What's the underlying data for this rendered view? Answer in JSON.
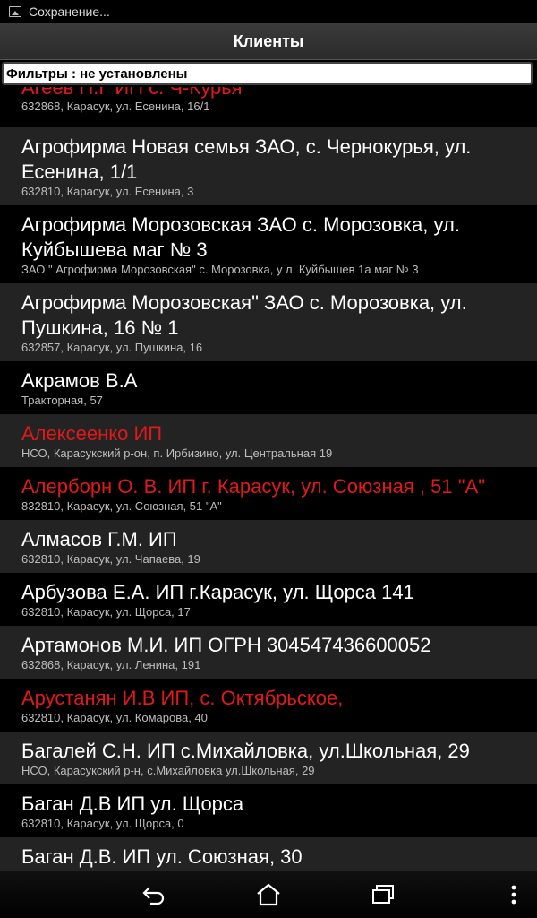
{
  "status": {
    "text": "Сохранение..."
  },
  "header": {
    "title": "Клиенты"
  },
  "filter": {
    "text": "Фильтры : не установлены"
  },
  "clients": [
    {
      "name": "Агеев П.Г ИП с. Ч-Курья",
      "address": "632868, Карасук, ул. Есенина, 16/1",
      "red": true
    },
    {
      "name": "Агрофирма  Новая семья ЗАО, с. Чернокурья, ул. Есенина, 1/1",
      "address": "632810, Карасук, ул. Есенина, 3",
      "red": false
    },
    {
      "name": "Агрофирма Морозовская ЗАО с. Морозовка, ул. Куйбышева маг № 3",
      "address": "ЗАО \" Агрофирма Морозовская\" с. Морозовка, у л. Куйбышев 1а маг № 3",
      "red": false
    },
    {
      "name": "Агрофирма Морозовская\" ЗАО с. Морозовка, ул. Пушкина, 16 № 1",
      "address": "632857, Карасук, ул. Пушкина, 16",
      "red": false
    },
    {
      "name": "Акрамов В.А",
      "address": "Тракторная, 57",
      "red": false
    },
    {
      "name": "Алексеенко ИП",
      "address": "НСО, Карасукский р-он, п. Ирбизино, ул. Центральная 19",
      "red": true
    },
    {
      "name": "Алерборн О. В. ИП г. Карасук, ул. Союзная , 51 \"А\"",
      "address": "832810, Карасук, ул. Союзная, 51 \"А\"",
      "red": true
    },
    {
      "name": "Алмасов Г.М. ИП",
      "address": "632810, Карасук, ул. Чапаева, 19",
      "red": false
    },
    {
      "name": "Арбузова Е.А. ИП  г.Карасук,  ул. Щорса 141",
      "address": "632810, Карасук, ул. Щорса, 17",
      "red": false
    },
    {
      "name": "Артамонов М.И. ИП ОГРН 304547436600052",
      "address": "632868, Карасук, ул. Ленина, 191",
      "red": false
    },
    {
      "name": "Арустанян И.В ИП, с. Октябрьское,",
      "address": "632810, Карасук, ул. Комарова, 40",
      "red": true
    },
    {
      "name": "Багалей С.Н. ИП с.Михайловка, ул.Школьная, 29",
      "address": "НСО, Карасукский р-н, с.Михайловка ул.Школьная, 29",
      "red": false
    },
    {
      "name": "Баган Д.В ИП ул. Щорса",
      "address": "632810, Карасук, ул. Щорса, 0",
      "red": false
    },
    {
      "name": "Баган Д.В. ИП ул. Союзная, 30",
      "address": "",
      "red": false
    }
  ],
  "navbar": {
    "back_icon": "back-icon",
    "home_icon": "home-icon",
    "recents_icon": "recents-icon",
    "menu_icon": "overflow-menu-icon"
  }
}
